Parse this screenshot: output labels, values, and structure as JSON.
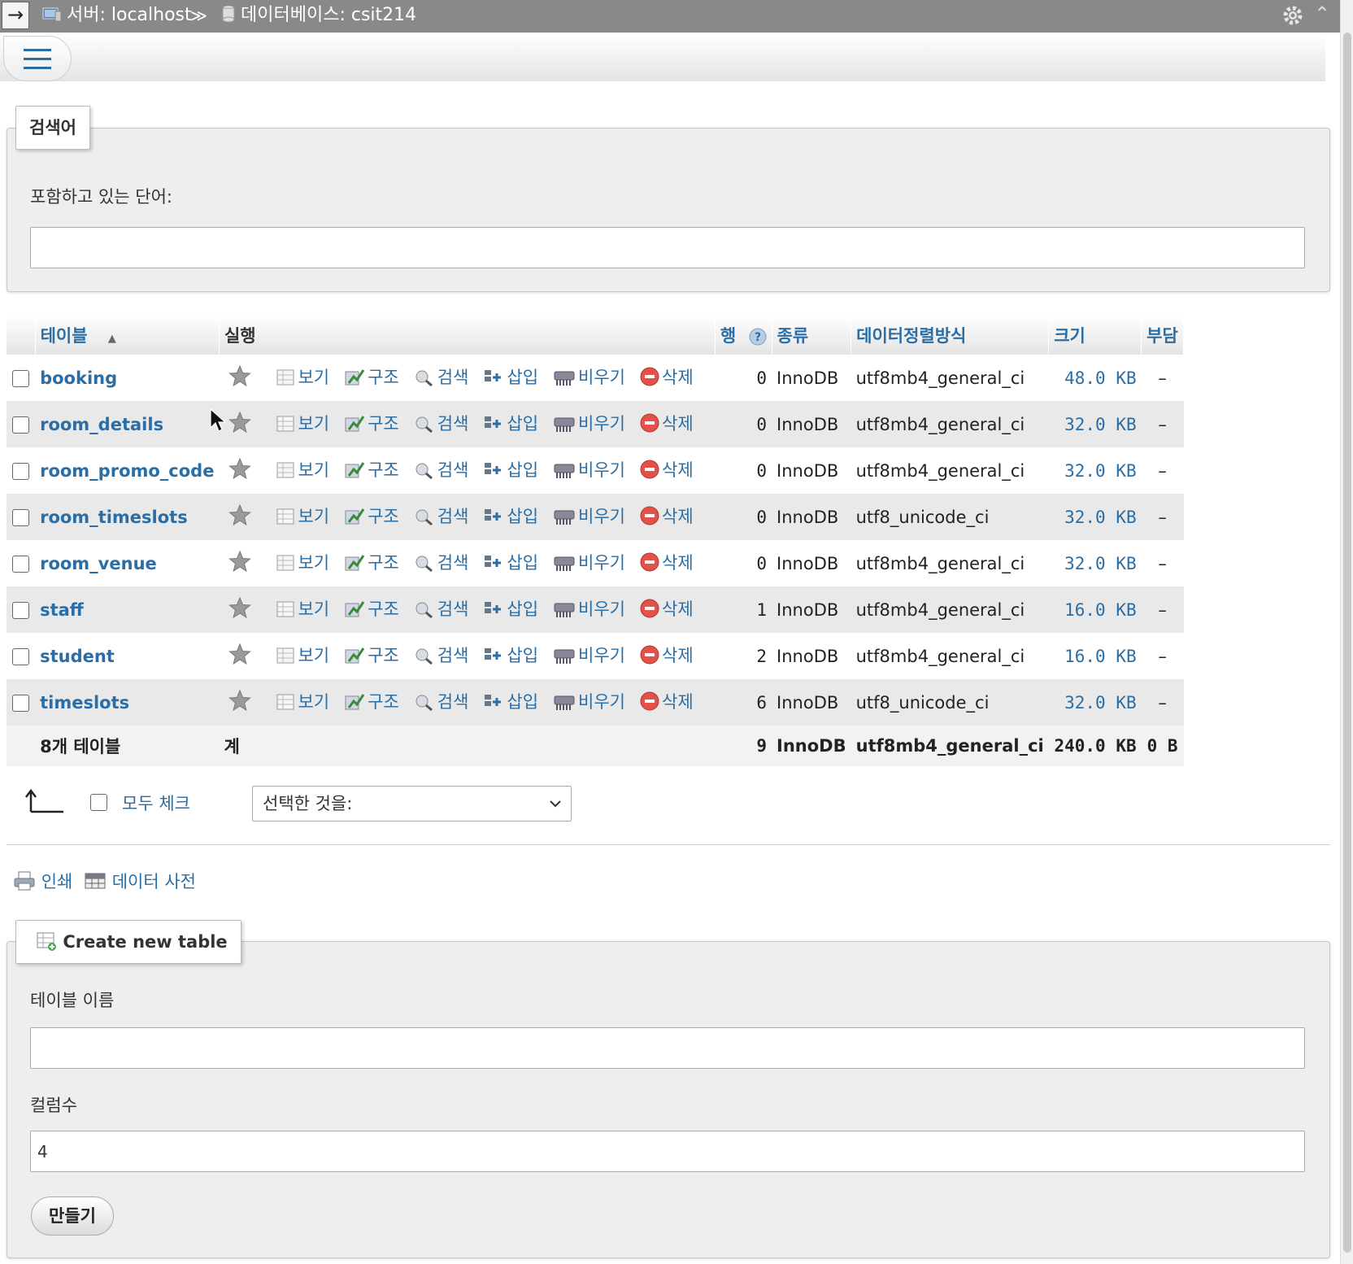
{
  "breadcrumb": {
    "server": "서버: localhost",
    "separator": "≫",
    "database": "데이터베이스: csit214"
  },
  "search": {
    "legend": "검색어",
    "label": "포함하고 있는 단어:",
    "value": ""
  },
  "table": {
    "headers": {
      "table": "테이블",
      "action": "실행",
      "rows": "행",
      "type": "종류",
      "collation": "데이터정렬방식",
      "size": "크기",
      "overhead": "부담"
    },
    "action_labels": {
      "browse": "보기",
      "structure": "구조",
      "search": "검색",
      "insert": "삽입",
      "empty": "비우기",
      "drop": "삭제"
    },
    "rows": [
      {
        "name": "booking",
        "rows": "0",
        "type": "InnoDB",
        "collation": "utf8mb4_general_ci",
        "size": "48.0 KB",
        "overhead": "–"
      },
      {
        "name": "room_details",
        "rows": "0",
        "type": "InnoDB",
        "collation": "utf8mb4_general_ci",
        "size": "32.0 KB",
        "overhead": "–"
      },
      {
        "name": "room_promo_code",
        "rows": "0",
        "type": "InnoDB",
        "collation": "utf8mb4_general_ci",
        "size": "32.0 KB",
        "overhead": "–"
      },
      {
        "name": "room_timeslots",
        "rows": "0",
        "type": "InnoDB",
        "collation": "utf8_unicode_ci",
        "size": "32.0 KB",
        "overhead": "–"
      },
      {
        "name": "room_venue",
        "rows": "0",
        "type": "InnoDB",
        "collation": "utf8mb4_general_ci",
        "size": "32.0 KB",
        "overhead": "–"
      },
      {
        "name": "staff",
        "rows": "1",
        "type": "InnoDB",
        "collation": "utf8mb4_general_ci",
        "size": "16.0 KB",
        "overhead": "–"
      },
      {
        "name": "student",
        "rows": "2",
        "type": "InnoDB",
        "collation": "utf8mb4_general_ci",
        "size": "16.0 KB",
        "overhead": "–"
      },
      {
        "name": "timeslots",
        "rows": "6",
        "type": "InnoDB",
        "collation": "utf8_unicode_ci",
        "size": "32.0 KB",
        "overhead": "–"
      }
    ],
    "footer": {
      "count": "8개 테이블",
      "sum_label": "계",
      "rows": "9",
      "type": "InnoDB",
      "collation": "utf8mb4_general_ci",
      "size": "240.0 KB",
      "overhead": "0 B"
    }
  },
  "bulk": {
    "check_all": "모두 체크",
    "with_selected": "선택한 것을:"
  },
  "links": {
    "print": "인쇄",
    "data_dictionary": "데이터 사전"
  },
  "create": {
    "legend": "Create new table",
    "name_label": "테이블 이름",
    "name_value": "",
    "columns_label": "컬럼수",
    "columns_value": "4",
    "submit": "만들기"
  }
}
